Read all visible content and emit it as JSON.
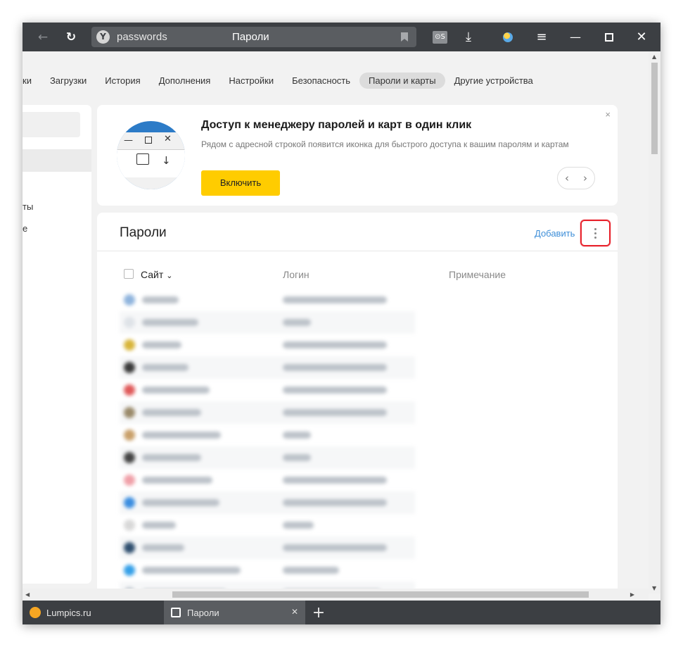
{
  "address_bar": {
    "url": "passwords",
    "page_title": "Пароли",
    "lastpass_label": "⊙S"
  },
  "settings_nav": {
    "items": [
      "ки",
      "Загрузки",
      "История",
      "Дополнения",
      "Настройки",
      "Безопасность",
      "Пароли и карты",
      "Другие устройства"
    ],
    "active": "Пароли и карты"
  },
  "left_panel": {
    "items": [
      "ты",
      "е"
    ]
  },
  "promo": {
    "title": "Доступ к менеджеру паролей и карт в один клик",
    "description": "Рядом с адресной строкой появится иконка для быстрого доступа к вашим паролям и картам",
    "button_label": "Включить",
    "close_label": "×",
    "prev_label": "‹",
    "next_label": "›"
  },
  "passwords": {
    "title": "Пароли",
    "add_label": "Добавить",
    "columns": {
      "site": "Сайт",
      "sort_indicator": "⌄",
      "login": "Логин",
      "note": "Примечание"
    }
  },
  "tabs": [
    {
      "label": "Lumpics.ru",
      "active": false
    },
    {
      "label": "Пароли",
      "active": true
    }
  ],
  "colors": {
    "accent": "#ffcc00",
    "link": "#3d8ed8",
    "highlight": "#e8232d",
    "titlebar": "#3c3f43"
  },
  "blurred_rows": [
    {
      "icon_color": "#8fb4dd",
      "site_w": 52,
      "login_w": 148
    },
    {
      "icon_color": "#dfe3e8",
      "site_w": 80,
      "login_w": 40
    },
    {
      "icon_color": "#d8b53a",
      "site_w": 56,
      "login_w": 148
    },
    {
      "icon_color": "#3a3a3a",
      "site_w": 66,
      "login_w": 148
    },
    {
      "icon_color": "#e05a5a",
      "site_w": 96,
      "login_w": 148
    },
    {
      "icon_color": "#9a8a6a",
      "site_w": 84,
      "login_w": 148
    },
    {
      "icon_color": "#c9a06a",
      "site_w": 112,
      "login_w": 40
    },
    {
      "icon_color": "#444444",
      "site_w": 84,
      "login_w": 40
    },
    {
      "icon_color": "#f0a0a8",
      "site_w": 100,
      "login_w": 148
    },
    {
      "icon_color": "#3b8ee0",
      "site_w": 110,
      "login_w": 148
    },
    {
      "icon_color": "#d8d8d8",
      "site_w": 48,
      "login_w": 44
    },
    {
      "icon_color": "#2f4f6f",
      "site_w": 60,
      "login_w": 148
    },
    {
      "icon_color": "#35a0e8",
      "site_w": 140,
      "login_w": 80
    },
    {
      "icon_color": "#c0c8d0",
      "site_w": 120,
      "login_w": 140
    }
  ]
}
